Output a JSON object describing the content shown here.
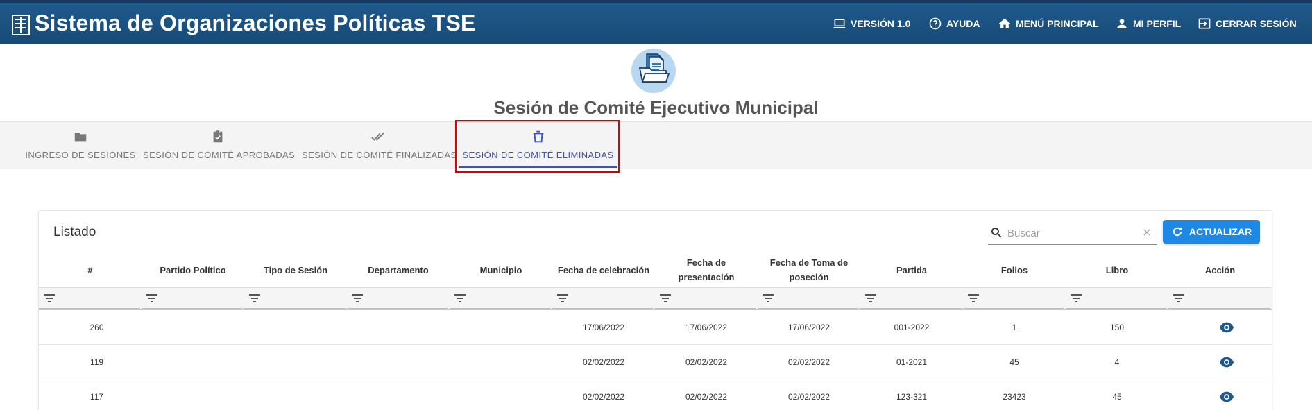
{
  "header": {
    "title": "Sistema de Organizaciones Políticas TSE",
    "nav": [
      {
        "label": "VERSIÓN 1.0",
        "icon": "laptop-icon"
      },
      {
        "label": "AYUDA",
        "icon": "help-circle-icon"
      },
      {
        "label": "MENÚ PRINCIPAL",
        "icon": "home-icon"
      },
      {
        "label": "MI PERFIL",
        "icon": "person-icon"
      },
      {
        "label": "CERRAR SESIÓN",
        "icon": "logout-icon"
      }
    ]
  },
  "page": {
    "title": "Sesión de Comité Ejecutivo Municipal",
    "icon": "folder-document-icon"
  },
  "tabs": [
    {
      "label": "INGRESO DE SESIONES",
      "icon": "folder-icon",
      "active": false
    },
    {
      "label": "SESIÓN DE COMITÉ APROBADAS",
      "icon": "clipboard-check-icon",
      "active": false
    },
    {
      "label": "SESIÓN DE COMITÉ FINALIZADAS",
      "icon": "double-check-icon",
      "active": false
    },
    {
      "label": "SESIÓN DE COMITÉ ELIMINADAS",
      "icon": "trash-icon",
      "active": true
    }
  ],
  "listing": {
    "title": "Listado",
    "search_placeholder": "Buscar",
    "refresh_label": "ACTUALIZAR",
    "columns": [
      "#",
      "Partido Político",
      "Tipo de Sesión",
      "Departamento",
      "Municipio",
      "Fecha de celebración",
      "Fecha de presentación",
      "Fecha de Toma de poseción",
      "Partida",
      "Folios",
      "Libro",
      "Acción"
    ],
    "rows": [
      {
        "num": "260",
        "partido": "",
        "tipo": "",
        "departamento": "",
        "municipio": "",
        "fecha_celebracion": "17/06/2022",
        "fecha_presentacion": "17/06/2022",
        "fecha_toma": "17/06/2022",
        "partida": "001-2022",
        "folios": "1",
        "libro": "150"
      },
      {
        "num": "119",
        "partido": "",
        "tipo": "",
        "departamento": "",
        "municipio": "",
        "fecha_celebracion": "02/02/2022",
        "fecha_presentacion": "02/02/2022",
        "fecha_toma": "02/02/2022",
        "partida": "01-2021",
        "folios": "45",
        "libro": "4"
      },
      {
        "num": "117",
        "partido": "",
        "tipo": "",
        "departamento": "",
        "municipio": "",
        "fecha_celebracion": "02/02/2022",
        "fecha_presentacion": "02/02/2022",
        "fecha_toma": "02/02/2022",
        "partida": "123-321",
        "folios": "23423",
        "libro": "45"
      }
    ]
  },
  "colors": {
    "header": "#1f5a8c",
    "accent": "#3f51b5",
    "button": "#1e88e5",
    "highlight": "#e00000",
    "eye": "#1f5a8c"
  }
}
